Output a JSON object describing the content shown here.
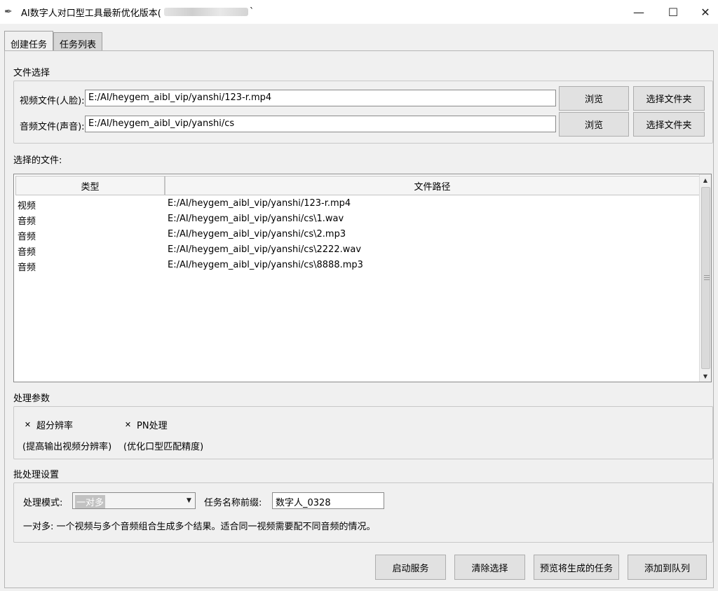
{
  "window": {
    "title": "AI数字人对口型工具最新优化版本(",
    "title_suffix": "`",
    "icon": "feather-icon",
    "controls": [
      "minimize-icon",
      "maximize-icon",
      "close-icon"
    ]
  },
  "tabs": [
    {
      "label": "创建任务",
      "active": true
    },
    {
      "label": "任务列表",
      "active": false
    }
  ],
  "file_select": {
    "title": "文件选择",
    "video_label": "视频文件(人脸):",
    "video_value": "E:/AI/heygem_aibl_vip/yanshi/123-r.mp4",
    "audio_label": "音频文件(声音):",
    "audio_value": "E:/AI/heygem_aibl_vip/yanshi/cs",
    "browse_label": "浏览",
    "folder_label": "选择文件夹"
  },
  "selected_files": {
    "title": "选择的文件:",
    "columns": [
      "类型",
      "文件路径"
    ],
    "rows": [
      {
        "type": "视频",
        "path": "E:/AI/heygem_aibl_vip/yanshi/123-r.mp4"
      },
      {
        "type": "音频",
        "path": "E:/AI/heygem_aibl_vip/yanshi/cs\\1.wav"
      },
      {
        "type": "音频",
        "path": "E:/AI/heygem_aibl_vip/yanshi/cs\\2.mp3"
      },
      {
        "type": "音频",
        "path": "E:/AI/heygem_aibl_vip/yanshi/cs\\2222.wav"
      },
      {
        "type": "音频",
        "path": "E:/AI/heygem_aibl_vip/yanshi/cs\\8888.mp3"
      }
    ]
  },
  "params": {
    "title": "处理参数",
    "super_res_label": "超分辨率",
    "super_res_checked": true,
    "super_res_desc": "(提高输出视频分辨率)",
    "pn_label": "PN处理",
    "pn_checked": true,
    "pn_desc": "(优化口型匹配精度)"
  },
  "batch": {
    "title": "批处理设置",
    "mode_label": "处理模式:",
    "mode_value": "一对多",
    "prefix_label": "任务名称前缀:",
    "prefix_value": "数字人_0328",
    "description": "一对多: 一个视频与多个音频组合生成多个结果。适合同一视频需要配不同音频的情况。"
  },
  "actions": {
    "start": "启动服务",
    "clear": "清除选择",
    "preview": "预览将生成的任务",
    "add": "添加到队列"
  }
}
